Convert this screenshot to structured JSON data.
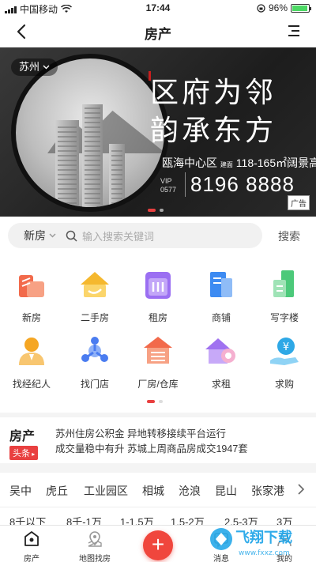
{
  "status_bar": {
    "carrier": "中国移动",
    "time": "17:44",
    "battery_percent": "96%",
    "battery_level": 0.96
  },
  "navbar": {
    "title": "房产"
  },
  "banner": {
    "city": "苏州",
    "slogan_line1": "区府为邻",
    "slogan_line2": "韵承东方",
    "area_text": "瓯海中心区",
    "area_sub": "建面",
    "area_range": "118-165㎡阔景高层",
    "vip_label": "VIP",
    "vip_code": "0577",
    "phone": "8196 8888",
    "ad_label": "广告",
    "slide_count": 2,
    "active_slide": 1
  },
  "search": {
    "category": "新房",
    "placeholder": "输入搜索关键词",
    "button_label": "搜索"
  },
  "categories": [
    {
      "label": "新房",
      "icon": "new-house-icon",
      "color": "#f26a4b"
    },
    {
      "label": "二手房",
      "icon": "second-hand-house-icon",
      "color": "#f5b82e"
    },
    {
      "label": "租房",
      "icon": "rent-icon",
      "color": "#9b6ff2"
    },
    {
      "label": "商铺",
      "icon": "shop-icon",
      "color": "#3d8bf2"
    },
    {
      "label": "写字楼",
      "icon": "office-building-icon",
      "color": "#4cc97a"
    },
    {
      "label": "找经纪人",
      "icon": "agent-icon",
      "color": "#f5a623"
    },
    {
      "label": "找门店",
      "icon": "store-finder-icon",
      "color": "#4a7cf0"
    },
    {
      "label": "厂房/仓库",
      "icon": "warehouse-icon",
      "color": "#f26a4b"
    },
    {
      "label": "求租",
      "icon": "want-rent-icon",
      "color": "#a072f0"
    },
    {
      "label": "求购",
      "icon": "want-buy-icon",
      "color": "#2ea8e6"
    }
  ],
  "category_pages": {
    "count": 2,
    "active": 1
  },
  "headlines": {
    "brand_top": "房产",
    "brand_bottom": "头条",
    "line1": "苏州住房公积金 异地转移接续平台运行",
    "line2": "成交量稳中有升 苏城上周商品房成交1947套"
  },
  "districts": [
    "吴中",
    "虎丘",
    "工业园区",
    "相城",
    "沧浪",
    "昆山",
    "张家港"
  ],
  "price_ranges": [
    "8千以下",
    "8千-1万",
    "1-1.5万",
    "1.5-2万",
    "2.5-3万",
    "3万"
  ],
  "tabbar": {
    "tabs": [
      {
        "label": "房产",
        "icon": "house-tab-icon"
      },
      {
        "label": "地图找房",
        "icon": "map-pin-icon"
      },
      {
        "label": "消息",
        "icon": "message-icon"
      },
      {
        "label": "我的",
        "icon": "profile-icon"
      }
    ],
    "center_button": "+"
  },
  "watermark": {
    "text": "飞翔下载",
    "url_text": "www.fxxz.com"
  },
  "colors": {
    "accent": "#e94040",
    "fab": "#f0463d"
  }
}
